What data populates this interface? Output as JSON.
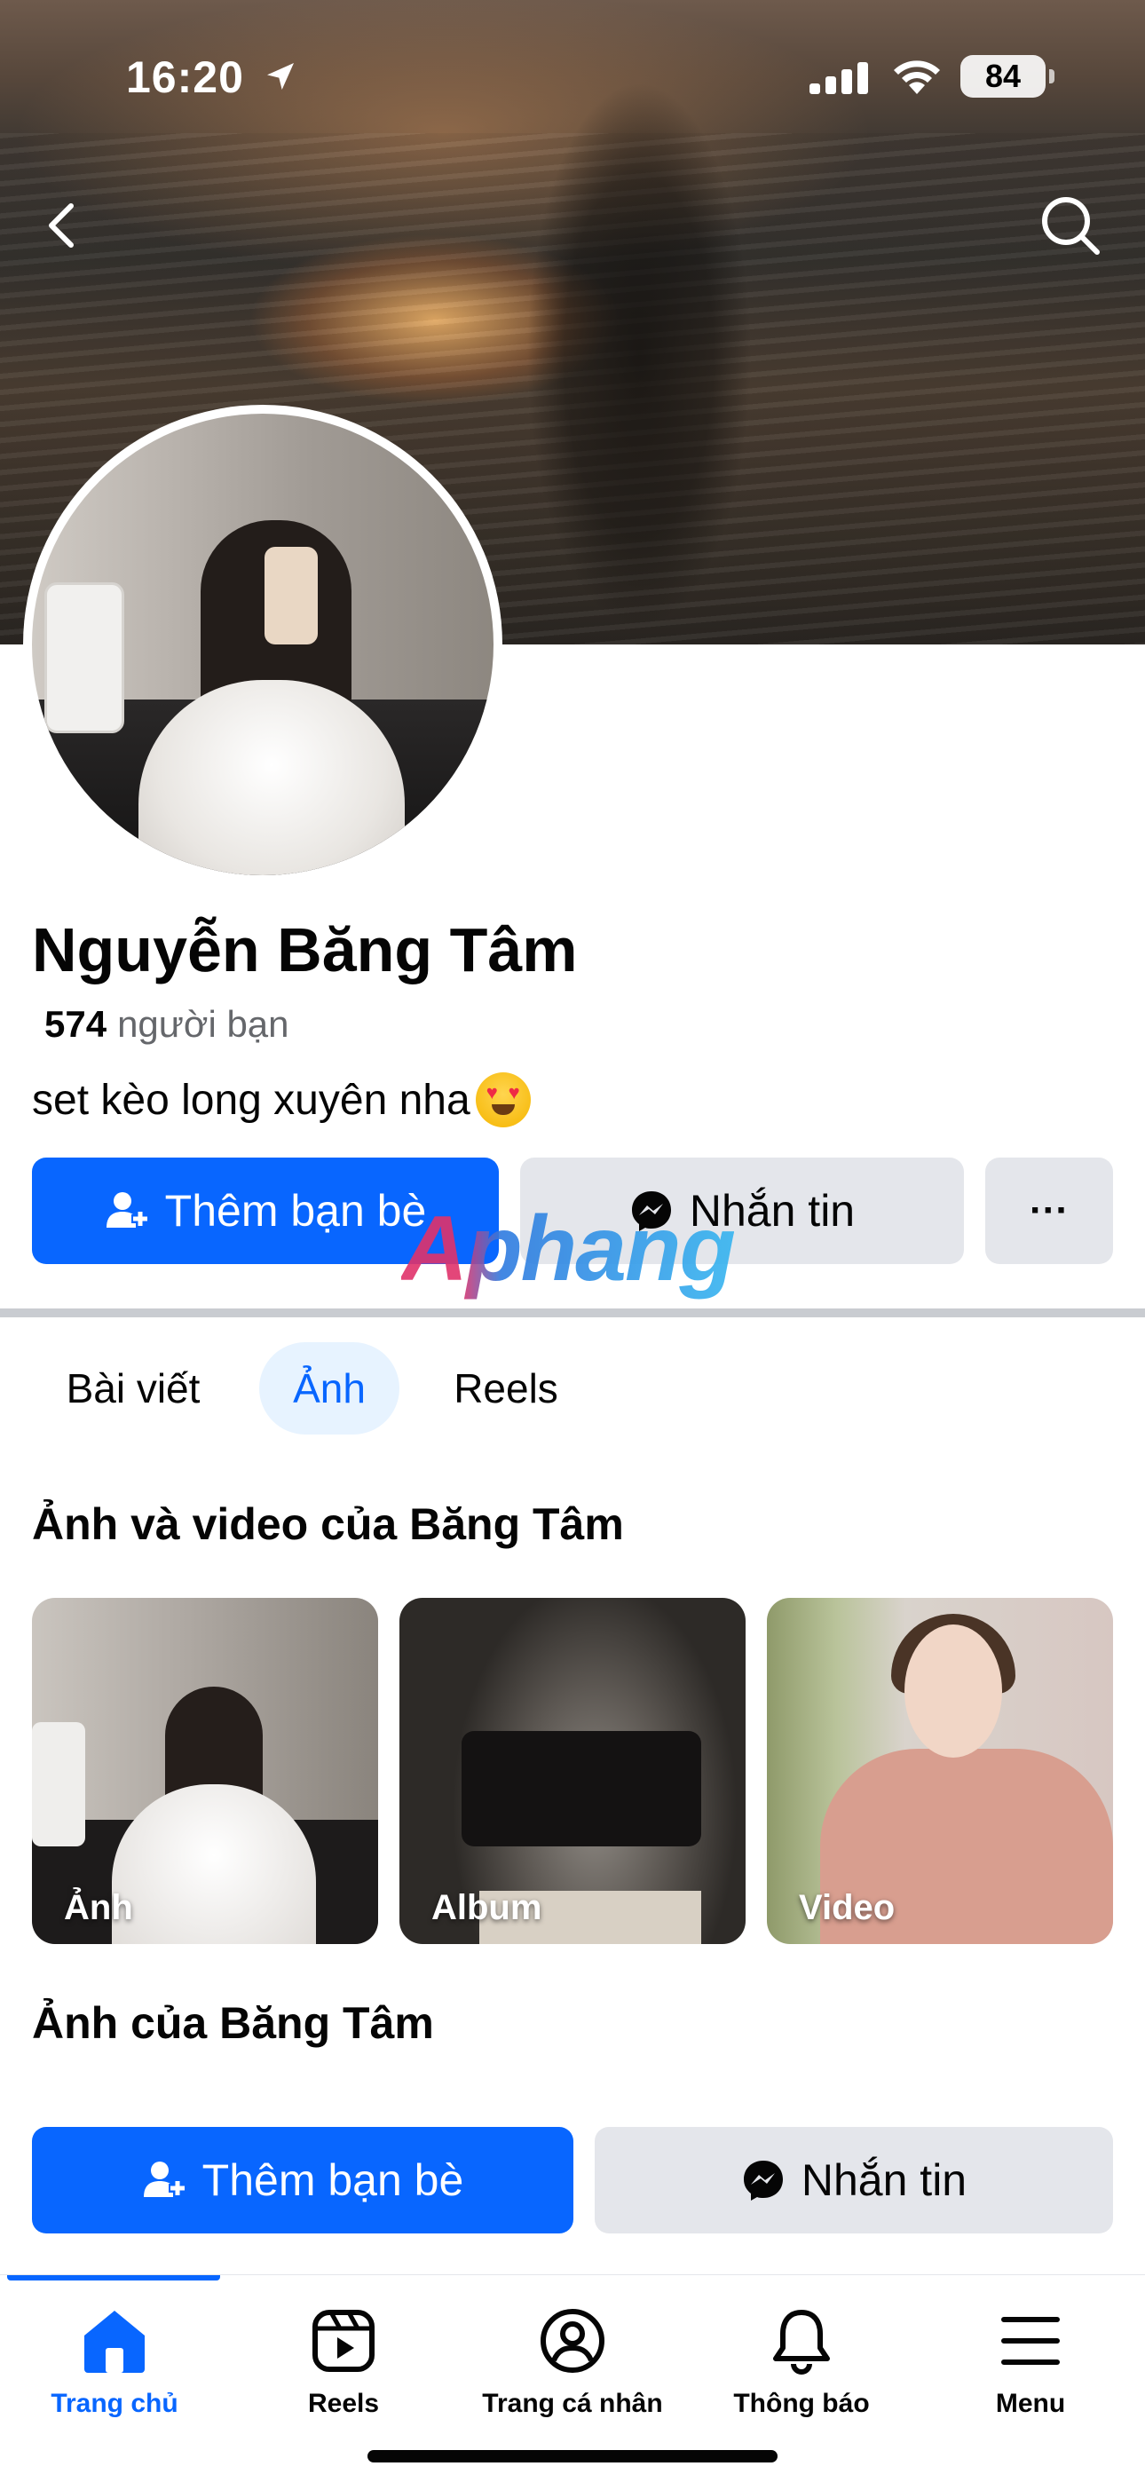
{
  "status": {
    "time": "16:20",
    "battery": "84"
  },
  "profile": {
    "name": "Nguyễn Băng Tâm",
    "friends_count": "574",
    "friends_label": "người bạn",
    "bio": "set kèo long xuyên nha"
  },
  "actions": {
    "add_friend": "Thêm bạn bè",
    "message": "Nhắn tin",
    "more": "···"
  },
  "watermark": "Aphang",
  "tabs": [
    {
      "label": "Bài viết",
      "active": false
    },
    {
      "label": "Ảnh",
      "active": true
    },
    {
      "label": "Reels",
      "active": false
    }
  ],
  "photos_section": {
    "title": "Ảnh và video của Băng Tâm",
    "items": [
      {
        "label": "Ảnh"
      },
      {
        "label": "Album"
      },
      {
        "label": "Video"
      }
    ]
  },
  "photos_of_section": {
    "title": "Ảnh của Băng Tâm"
  },
  "bottom_actions": {
    "add_friend": "Thêm bạn bè",
    "message": "Nhắn tin"
  },
  "nav": [
    {
      "label": "Trang chủ",
      "icon": "home-icon",
      "active": true
    },
    {
      "label": "Reels",
      "icon": "reels-icon",
      "active": false
    },
    {
      "label": "Trang cá nhân",
      "icon": "profile-icon",
      "active": false
    },
    {
      "label": "Thông báo",
      "icon": "bell-icon",
      "active": false
    },
    {
      "label": "Menu",
      "icon": "menu-icon",
      "active": false
    }
  ],
  "colors": {
    "primary": "#0866ff",
    "secondary_button": "#e4e6eb",
    "active_tab_bg": "#e7f3ff",
    "muted_text": "#65676b"
  }
}
